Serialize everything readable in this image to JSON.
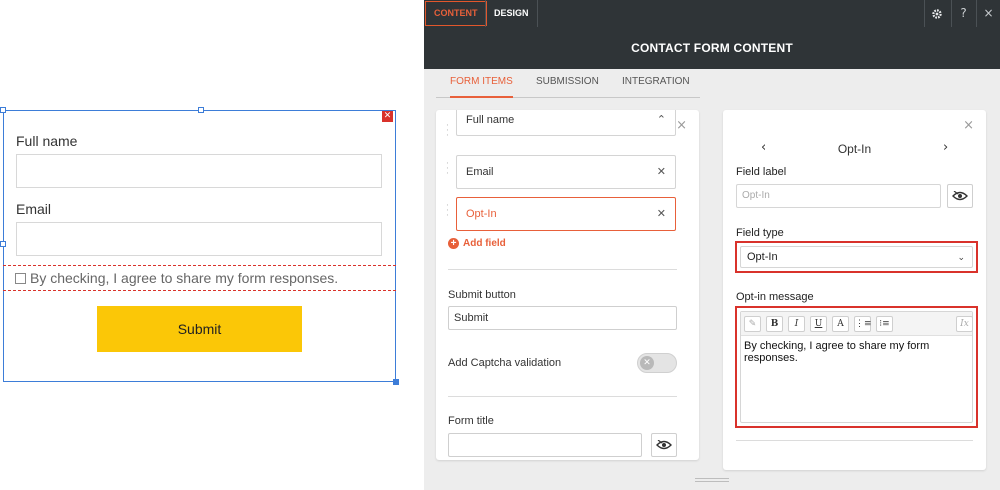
{
  "preview": {
    "full_name_label": "Full name",
    "email_label": "Email",
    "optin_text": "By checking, I agree to share my form responses.",
    "submit_label": "Submit",
    "colors": {
      "selection": "#3d7dd8",
      "submit_bg": "#fbc707",
      "highlight": "#d9322b"
    }
  },
  "editor": {
    "tabs": [
      {
        "label": "CONTENT",
        "active": true
      },
      {
        "label": "DESIGN",
        "active": false
      }
    ],
    "icons": {
      "settings": "gear-icon",
      "help": "?",
      "close": "×"
    },
    "title": "CONTACT FORM CONTENT",
    "subtabs": [
      {
        "label": "FORM ITEMS",
        "active": true
      },
      {
        "label": "SUBMISSION",
        "active": false
      },
      {
        "label": "INTEGRATION",
        "active": false
      }
    ],
    "form_items": {
      "fields": [
        {
          "label": "Full name",
          "selected": false
        },
        {
          "label": "Email",
          "selected": false
        },
        {
          "label": "Opt-In",
          "selected": true
        }
      ],
      "add_field_label": "Add field",
      "submit_button_label": "Submit button",
      "submit_button_value": "Submit",
      "captcha_label": "Add Captcha validation",
      "captcha_enabled": false,
      "form_title_label": "Form title",
      "form_title_value": ""
    },
    "field_settings": {
      "nav_title": "Opt-In",
      "field_label_label": "Field label",
      "field_label_placeholder": "Opt-In",
      "field_type_label": "Field type",
      "field_type_value": "Opt-In",
      "optin_message_label": "Opt-in message",
      "toolbar": [
        "link",
        "B",
        "I",
        "U",
        "A",
        "bullet-list",
        "numbered-list",
        "clear-format"
      ],
      "optin_message_value": "By checking, I agree to share my form responses."
    },
    "colors": {
      "dark_bar": "#2f3437",
      "accent": "#e8603a",
      "highlight_box": "#d9322b"
    }
  }
}
